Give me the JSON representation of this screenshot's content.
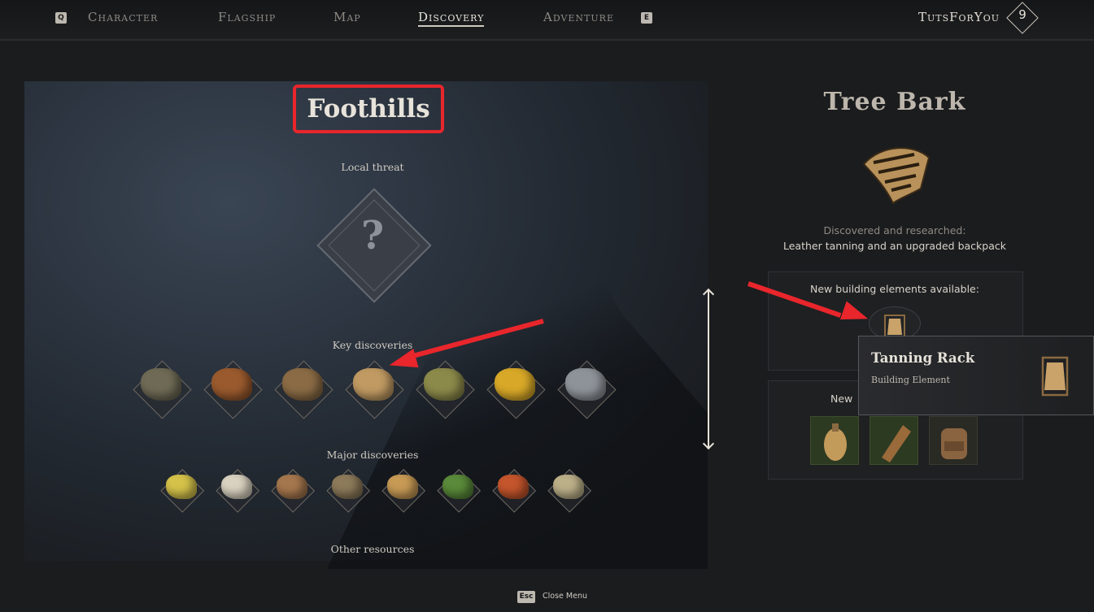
{
  "nav": {
    "key_left": "Q",
    "tabs": [
      "Character",
      "Flagship",
      "Map",
      "Discovery",
      "Adventure"
    ],
    "active_tab": "Discovery",
    "key_right": "E",
    "username": "TutsForYou",
    "level": "9"
  },
  "left": {
    "region_title": "Foothills",
    "local_threat_label": "Local threat",
    "threat_symbol": "?",
    "key_discoveries_label": "Key discoveries",
    "key_discoveries": [
      {
        "icon": "stone-icon",
        "color": "#6e6a55"
      },
      {
        "icon": "copper-ore-icon",
        "color": "#9a5a2e"
      },
      {
        "icon": "wood-log-icon",
        "color": "#8a6b45"
      },
      {
        "icon": "tree-bark-icon",
        "color": "#c09a62"
      },
      {
        "icon": "flax-icon",
        "color": "#8c8a4a"
      },
      {
        "icon": "corn-icon",
        "color": "#d8a828"
      },
      {
        "icon": "iron-ingot-icon",
        "color": "#8e9399"
      }
    ],
    "major_discoveries_label": "Major discoveries",
    "major_discoveries": [
      {
        "icon": "sulfur-icon",
        "color": "#d4c24a"
      },
      {
        "icon": "tusk-icon",
        "color": "#d9d2c0"
      },
      {
        "icon": "meat-icon",
        "color": "#a5774e"
      },
      {
        "icon": "grain-sack-icon",
        "color": "#8c7a5a"
      },
      {
        "icon": "seeds-icon",
        "color": "#c79a55"
      },
      {
        "icon": "lime-icon",
        "color": "#5a8a3a"
      },
      {
        "icon": "tomato-icon",
        "color": "#c4552c"
      },
      {
        "icon": "fibers-icon",
        "color": "#bcb089"
      }
    ],
    "other_resources_label": "Other resources"
  },
  "right": {
    "item_title": "Tree Bark",
    "discovered_label": "Discovered and researched:",
    "discovered_text": "Leather tanning and an upgraded backpack",
    "new_building_label": "New building elements available:",
    "new_items_label": "New",
    "tooltip": {
      "name": "Tanning Rack",
      "type": "Building Element"
    },
    "new_items": [
      {
        "icon": "waterskin-icon"
      },
      {
        "icon": "quiver-icon"
      },
      {
        "icon": "backpack-icon"
      }
    ]
  },
  "footer": {
    "esc_key": "Esc",
    "close_label": "Close Menu"
  },
  "colors": {
    "highlight_red": "#e8262c",
    "text_primary": "#e6e2da",
    "text_muted": "#8e8a84"
  }
}
